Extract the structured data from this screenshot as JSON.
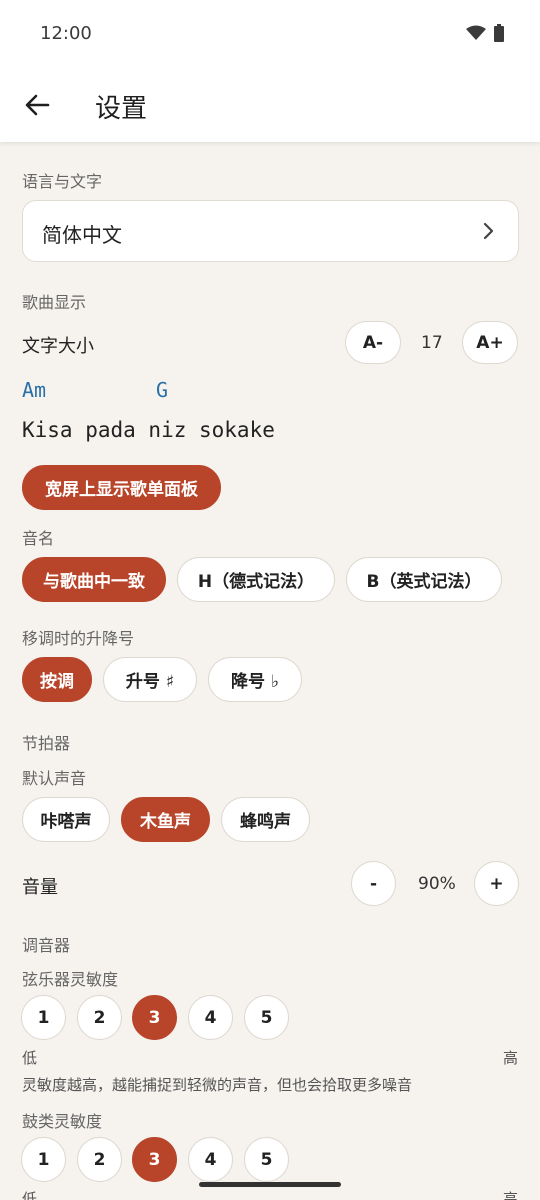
{
  "status": {
    "time": "12:00"
  },
  "appbar": {
    "title": "设置"
  },
  "language": {
    "section": "语言与文字",
    "value": "简体中文"
  },
  "song_display": {
    "section": "歌曲显示",
    "font_size_label": "文字大小",
    "decrease": "A-",
    "font_size": "17",
    "increase": "A+",
    "chord1": "Am",
    "chord2": "G",
    "lyric": "Kisa pada niz sokake",
    "wide_button": "宽屏上显示歌单面板"
  },
  "note_name": {
    "section": "音名",
    "options": [
      "与歌曲中一致",
      "H（德式记法）",
      "B（英式记法）"
    ]
  },
  "transpose": {
    "section": "移调时的升降号",
    "options": [
      "按调",
      "升号 ♯",
      "降号 ♭"
    ]
  },
  "metronome": {
    "section": "节拍器",
    "sound_label": "默认声音",
    "sounds": [
      "咔嗒声",
      "木鱼声",
      "蜂鸣声"
    ],
    "volume_label": "音量",
    "minus": "-",
    "volume": "90%",
    "plus": "+"
  },
  "tuner": {
    "section": "调音器",
    "string_label": "弦乐器灵敏度",
    "levels": [
      "1",
      "2",
      "3",
      "4",
      "5"
    ],
    "low": "低",
    "high": "高",
    "hint": "灵敏度越高，越能捕捉到轻微的声音，但也会拾取更多噪音",
    "drum_label": "鼓类灵敏度",
    "drum_levels": [
      "1",
      "2",
      "3",
      "4",
      "5"
    ],
    "drum_low": "低",
    "drum_high": "高"
  },
  "colors": {
    "accent": "#b8442a",
    "chord": "#2a6fa6",
    "background": "#f6f3ee"
  }
}
